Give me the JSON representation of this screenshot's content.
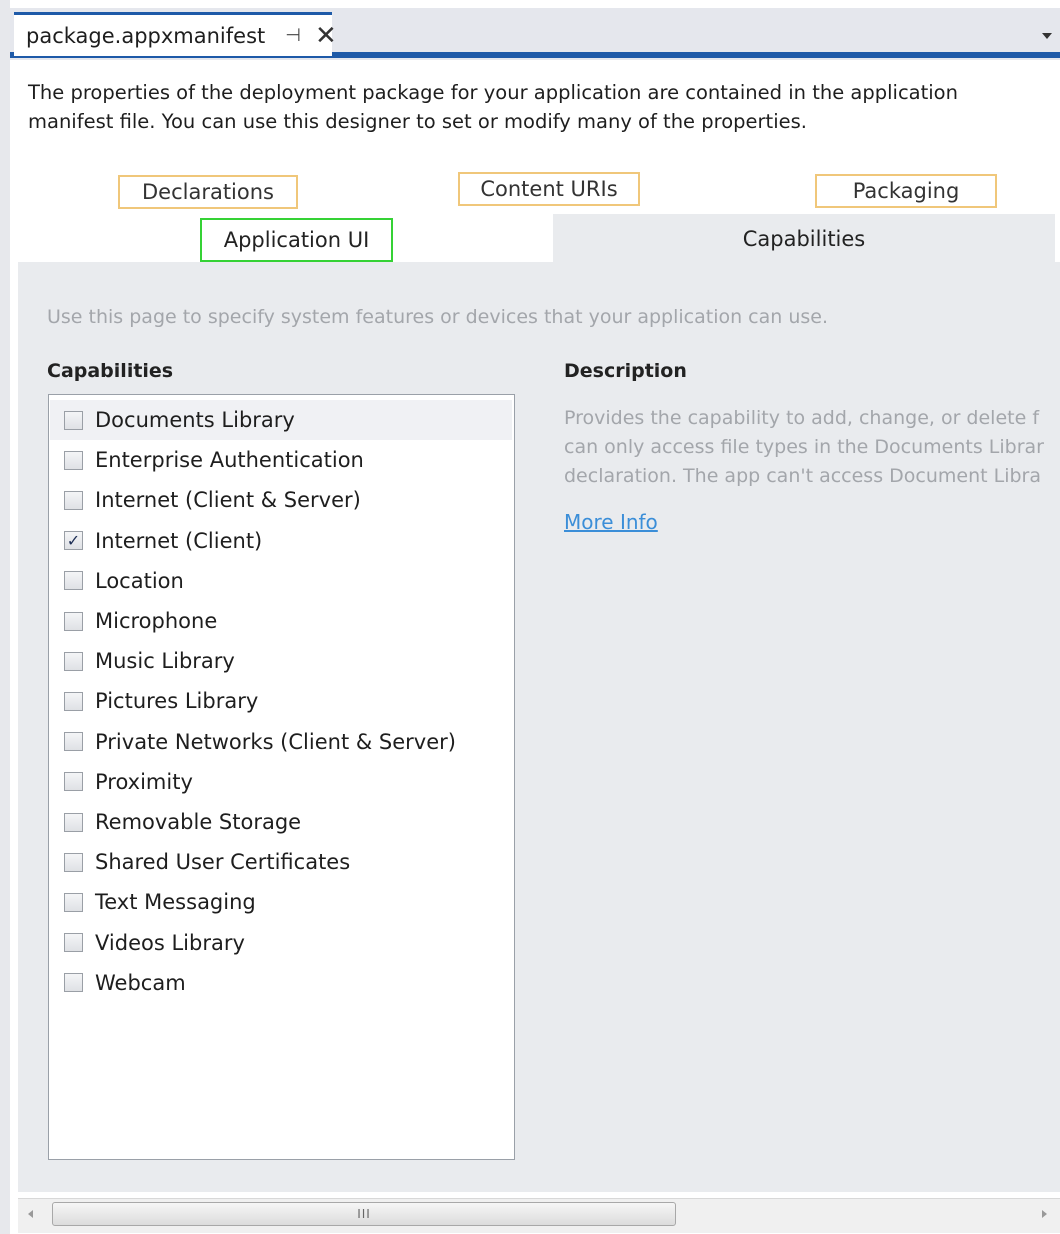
{
  "document_tab": {
    "title": "package.appxmanifest",
    "pin_glyph": "⊣",
    "close_glyph": "✕"
  },
  "intro": "The properties of the deployment package for your application are contained in the application manifest file. You can use this designer to set or modify many of the properties.",
  "tabs": {
    "declarations": "Declarations",
    "content_uris": "Content URIs",
    "packaging": "Packaging",
    "application_ui": "Application UI",
    "capabilities": "Capabilities"
  },
  "page": {
    "hint": "Use this page to specify system features or devices that your application can use.",
    "capabilities_heading": "Capabilities",
    "description_heading": "Description",
    "description_lines": [
      "Provides the capability to add, change, or delete f",
      "can only access file types in the Documents Librar",
      "declaration. The app can't access Document Libra"
    ],
    "more_info": "More Info"
  },
  "capabilities": [
    {
      "label": "Documents Library",
      "checked": false,
      "selected": true
    },
    {
      "label": "Enterprise Authentication",
      "checked": false
    },
    {
      "label": "Internet (Client & Server)",
      "checked": false
    },
    {
      "label": "Internet (Client)",
      "checked": true
    },
    {
      "label": "Location",
      "checked": false
    },
    {
      "label": "Microphone",
      "checked": false
    },
    {
      "label": "Music Library",
      "checked": false
    },
    {
      "label": "Pictures Library",
      "checked": false
    },
    {
      "label": "Private Networks (Client & Server)",
      "checked": false
    },
    {
      "label": "Proximity",
      "checked": false
    },
    {
      "label": "Removable Storage",
      "checked": false
    },
    {
      "label": "Shared User Certificates",
      "checked": false
    },
    {
      "label": "Text Messaging",
      "checked": false
    },
    {
      "label": "Videos Library",
      "checked": false
    },
    {
      "label": "Webcam",
      "checked": false
    }
  ],
  "scrollbar": {
    "grip": "III"
  },
  "colors": {
    "accent": "#1e5aa8",
    "tab_border": "#f0c77a",
    "highlight_border": "#35d235",
    "link": "#3b8ed8"
  }
}
